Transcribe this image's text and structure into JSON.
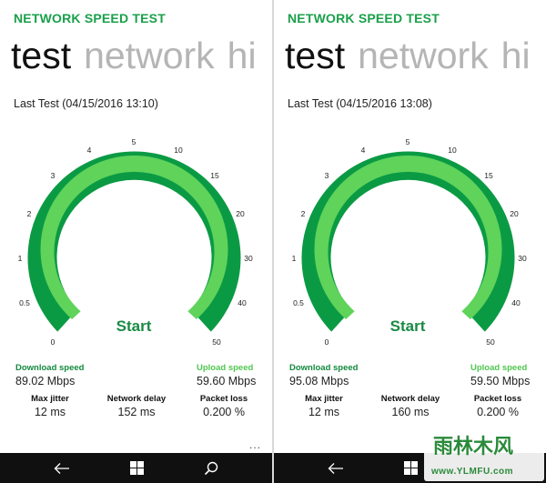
{
  "colors": {
    "accent": "#1aa04a",
    "arc_outer": "#0b9a44",
    "arc_inner": "#5fd35a",
    "start": "#1a8a45"
  },
  "gauge_ticks": [
    "0",
    "0.5",
    "1",
    "2",
    "3",
    "4",
    "5",
    "10",
    "15",
    "20",
    "30",
    "40",
    "50"
  ],
  "screens": [
    {
      "app_title": "NETWORK SPEED TEST",
      "pivot": [
        "test",
        "network",
        "hi"
      ],
      "last_test": "Last Test (04/15/2016 13:10)",
      "start_label": "Start",
      "download_label": "Download speed",
      "download_value": "89.02 Mbps",
      "upload_label": "Upload speed",
      "upload_value": "59.60 Mbps",
      "jitter_label": "Max jitter",
      "jitter_value": "12 ms",
      "delay_label": "Network delay",
      "delay_value": "152 ms",
      "loss_label": "Packet loss",
      "loss_value": "0.200 %",
      "more": "..."
    },
    {
      "app_title": "NETWORK SPEED TEST",
      "pivot": [
        "test",
        "network",
        "hi"
      ],
      "last_test": "Last Test (04/15/2016 13:08)",
      "start_label": "Start",
      "download_label": "Download speed",
      "download_value": "95.08 Mbps",
      "upload_label": "Upload speed",
      "upload_value": "59.50 Mbps",
      "jitter_label": "Max jitter",
      "jitter_value": "12 ms",
      "delay_label": "Network delay",
      "delay_value": "160 ms",
      "loss_label": "Packet loss",
      "loss_value": "0.200 %"
    }
  ],
  "navbar": {
    "back_icon": "back-arrow-icon",
    "home_icon": "windows-logo-icon",
    "search_icon": "search-icon"
  },
  "watermark": {
    "title": "雨林木风",
    "url": "www.YLMFU.com"
  }
}
